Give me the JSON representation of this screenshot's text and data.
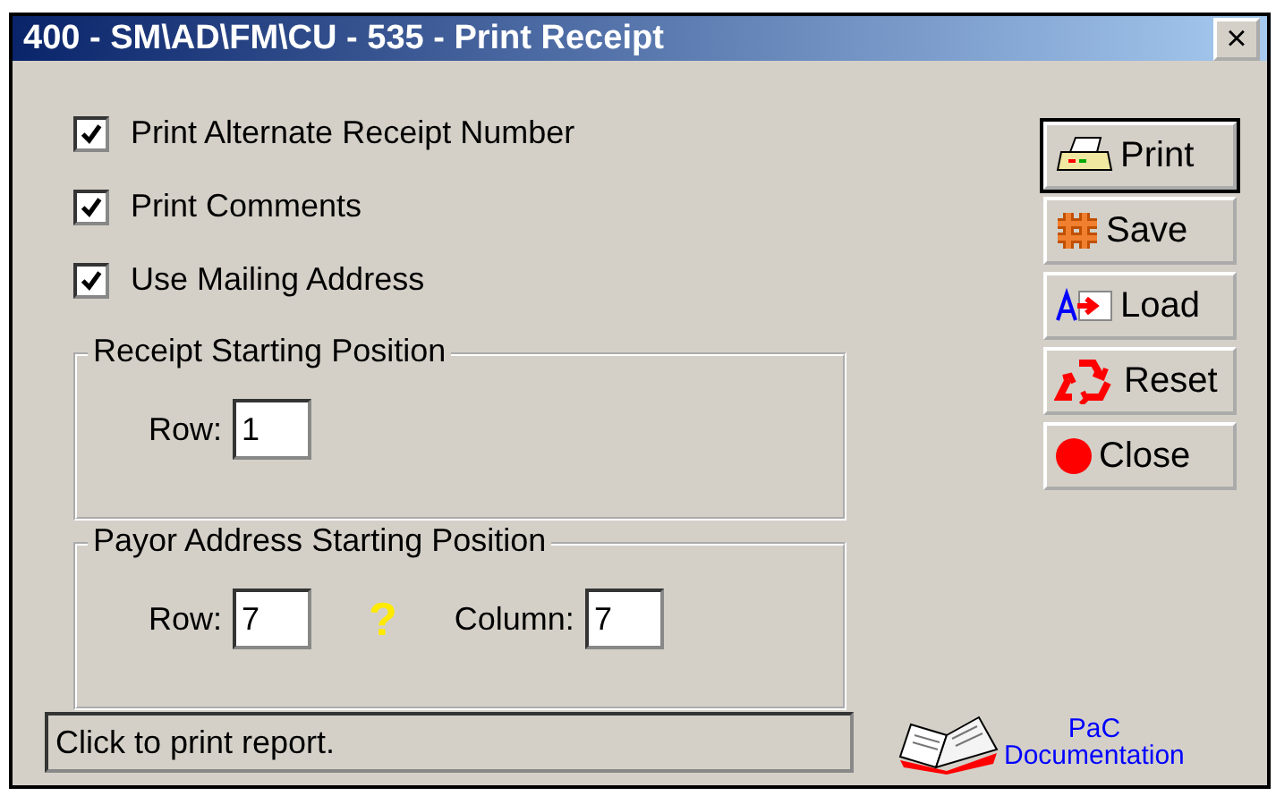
{
  "window": {
    "title": "400 - SM\\AD\\FM\\CU - 535 - Print Receipt",
    "close": "×"
  },
  "options": [
    {
      "label": "Print Alternate Receipt Number",
      "checked": true
    },
    {
      "label": "Print Comments",
      "checked": true
    },
    {
      "label": "Use Mailing Address",
      "checked": true
    }
  ],
  "receipt_group": {
    "title": "Receipt Starting Position",
    "row_label": "Row:",
    "row_value": "1"
  },
  "payor_group": {
    "title": "Payor Address Starting Position",
    "row_label": "Row:",
    "row_value": "7",
    "help": "?",
    "column_label": "Column:",
    "column_value": "7"
  },
  "buttons": [
    {
      "label": "Print",
      "kind": "print",
      "default": true
    },
    {
      "label": "Save",
      "kind": "save",
      "default": false
    },
    {
      "label": "Load",
      "kind": "load",
      "default": false
    },
    {
      "label": "Reset",
      "kind": "reset",
      "default": false
    },
    {
      "label": "Close",
      "kind": "close",
      "default": false
    }
  ],
  "status_bar": "Click to print report.",
  "documentation": {
    "line_1": "PaC",
    "line_2": "Documentation"
  }
}
